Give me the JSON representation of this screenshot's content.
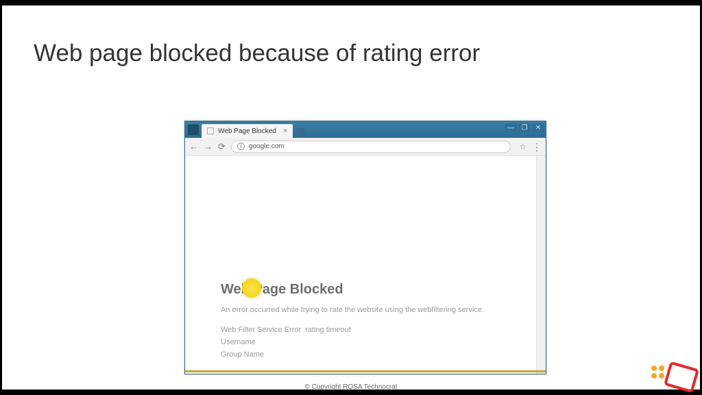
{
  "slide": {
    "title": "Web page blocked because of rating error",
    "footer": "© Copyright ROSA Technocrat"
  },
  "browser": {
    "tab_title": "Web Page Blocked",
    "url": "google.com",
    "winbtns": {
      "min": "—",
      "max": "❐",
      "close": "✕"
    },
    "nav": {
      "back": "←",
      "fwd": "→",
      "reload": "⟳",
      "info": "i",
      "star": "☆",
      "menu": "⋮"
    }
  },
  "page": {
    "heading": "Web Page Blocked",
    "message": "An error occurred while trying to rate the website using the webfiltering service.",
    "rows": [
      {
        "label": "Web Filter Service Error",
        "value": "rating timeout"
      },
      {
        "label": "Username",
        "value": ""
      },
      {
        "label": "Group Name",
        "value": ""
      }
    ]
  }
}
